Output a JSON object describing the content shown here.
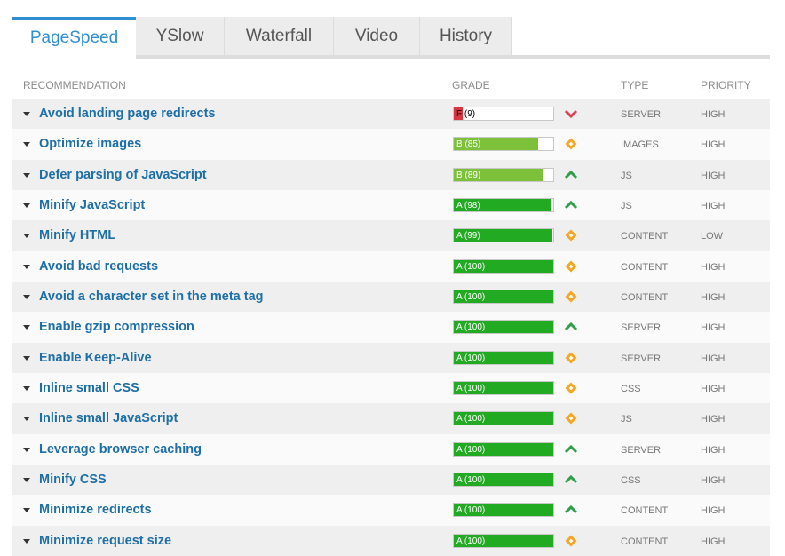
{
  "tabs": [
    {
      "label": "PageSpeed",
      "active": true
    },
    {
      "label": "YSlow",
      "active": false
    },
    {
      "label": "Waterfall",
      "active": false
    },
    {
      "label": "Video",
      "active": false
    },
    {
      "label": "History",
      "active": false
    }
  ],
  "columns": {
    "recommendation": "RECOMMENDATION",
    "grade": "GRADE",
    "type": "TYPE",
    "priority": "PRIORITY"
  },
  "colors": {
    "accent": "#2f8fd0",
    "grade_a": "#22aa22",
    "grade_b": "#7dc13a",
    "grade_f": "#d9343f",
    "icon_up": "#2e9e49",
    "icon_down": "#e0404d",
    "icon_neutral": "#f5a623"
  },
  "rows": [
    {
      "recommendation": "Avoid landing page redirects",
      "grade_label": "F (9)",
      "score": 9,
      "grade": "F",
      "trend": "down-chevron-icon",
      "type": "SERVER",
      "priority": "HIGH"
    },
    {
      "recommendation": "Optimize images",
      "grade_label": "B (85)",
      "score": 85,
      "grade": "B",
      "trend": "diamond-icon",
      "type": "IMAGES",
      "priority": "HIGH"
    },
    {
      "recommendation": "Defer parsing of JavaScript",
      "grade_label": "B (89)",
      "score": 89,
      "grade": "B",
      "trend": "up-chevron-icon",
      "type": "JS",
      "priority": "HIGH"
    },
    {
      "recommendation": "Minify JavaScript",
      "grade_label": "A (98)",
      "score": 98,
      "grade": "A",
      "trend": "up-chevron-icon",
      "type": "JS",
      "priority": "HIGH"
    },
    {
      "recommendation": "Minify HTML",
      "grade_label": "A (99)",
      "score": 99,
      "grade": "A",
      "trend": "diamond-icon",
      "type": "CONTENT",
      "priority": "LOW"
    },
    {
      "recommendation": "Avoid bad requests",
      "grade_label": "A (100)",
      "score": 100,
      "grade": "A",
      "trend": "diamond-icon",
      "type": "CONTENT",
      "priority": "HIGH"
    },
    {
      "recommendation": "Avoid a character set in the meta tag",
      "grade_label": "A (100)",
      "score": 100,
      "grade": "A",
      "trend": "diamond-icon",
      "type": "CONTENT",
      "priority": "HIGH"
    },
    {
      "recommendation": "Enable gzip compression",
      "grade_label": "A (100)",
      "score": 100,
      "grade": "A",
      "trend": "up-chevron-icon",
      "type": "SERVER",
      "priority": "HIGH"
    },
    {
      "recommendation": "Enable Keep-Alive",
      "grade_label": "A (100)",
      "score": 100,
      "grade": "A",
      "trend": "diamond-icon",
      "type": "SERVER",
      "priority": "HIGH"
    },
    {
      "recommendation": "Inline small CSS",
      "grade_label": "A (100)",
      "score": 100,
      "grade": "A",
      "trend": "diamond-icon",
      "type": "CSS",
      "priority": "HIGH"
    },
    {
      "recommendation": "Inline small JavaScript",
      "grade_label": "A (100)",
      "score": 100,
      "grade": "A",
      "trend": "diamond-icon",
      "type": "JS",
      "priority": "HIGH"
    },
    {
      "recommendation": "Leverage browser caching",
      "grade_label": "A (100)",
      "score": 100,
      "grade": "A",
      "trend": "up-chevron-icon",
      "type": "SERVER",
      "priority": "HIGH"
    },
    {
      "recommendation": "Minify CSS",
      "grade_label": "A (100)",
      "score": 100,
      "grade": "A",
      "trend": "up-chevron-icon",
      "type": "CSS",
      "priority": "HIGH"
    },
    {
      "recommendation": "Minimize redirects",
      "grade_label": "A (100)",
      "score": 100,
      "grade": "A",
      "trend": "up-chevron-icon",
      "type": "CONTENT",
      "priority": "HIGH"
    },
    {
      "recommendation": "Minimize request size",
      "grade_label": "A (100)",
      "score": 100,
      "grade": "A",
      "trend": "diamond-icon",
      "type": "CONTENT",
      "priority": "HIGH"
    }
  ]
}
